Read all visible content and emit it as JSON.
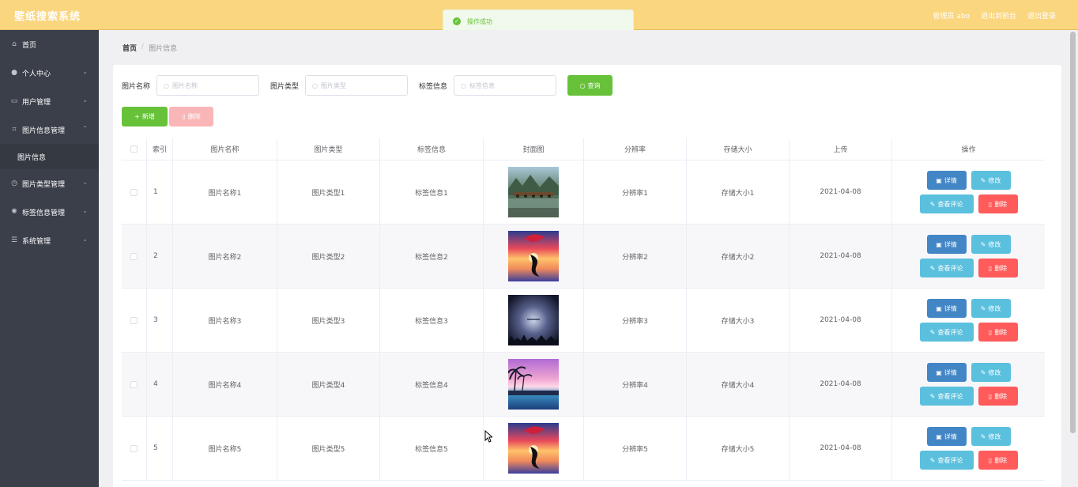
{
  "app": {
    "title": "壁纸搜索系统"
  },
  "topbar": {
    "admin": "管理员 abo",
    "back_frontend": "退出到前台",
    "logout": "退出登录"
  },
  "toast": {
    "message": "操作成功"
  },
  "sidebar": {
    "items": [
      {
        "label": "首页",
        "icon": "home-icon",
        "has_chevron": false
      },
      {
        "label": "个人中心",
        "icon": "user-icon",
        "has_chevron": true
      },
      {
        "label": "用户管理",
        "icon": "id-card-icon",
        "has_chevron": true
      },
      {
        "label": "图片信息管理",
        "icon": "crop-icon",
        "has_chevron": true,
        "expanded": true
      },
      {
        "label": "图片信息",
        "sub": true
      },
      {
        "label": "图片类型管理",
        "icon": "clock-icon",
        "has_chevron": true
      },
      {
        "label": "标签信息管理",
        "icon": "aperture-icon",
        "has_chevron": true
      },
      {
        "label": "系统管理",
        "icon": "stack-icon",
        "has_chevron": true
      }
    ]
  },
  "breadcrumb": {
    "home": "首页",
    "separator": "/",
    "current": "图片信息"
  },
  "search": {
    "fields": [
      {
        "label": "图片名称",
        "placeholder": "图片名称",
        "value": ""
      },
      {
        "label": "图片类型",
        "placeholder": "图片类型",
        "value": ""
      },
      {
        "label": "标签信息",
        "placeholder": "标签信息",
        "value": ""
      }
    ],
    "query_label": "查询"
  },
  "actions": {
    "add_label": "新增",
    "delete_label": "删除"
  },
  "table": {
    "headers": [
      "",
      "索引",
      "图片名称",
      "图片类型",
      "标签信息",
      "封面图",
      "分辨率",
      "存储大小",
      "上传",
      "操作"
    ],
    "rows": [
      {
        "index": "1",
        "name": "图片名称1",
        "type": "图片类型1",
        "tag": "标签信息1",
        "cover": "bridge-landscape",
        "resolution": "分辨率1",
        "size": "存储大小1",
        "uploaded": "2021-04-08"
      },
      {
        "index": "2",
        "name": "图片名称2",
        "type": "图片类型2",
        "tag": "标签信息2",
        "cover": "sunset-dolphin",
        "resolution": "分辨率2",
        "size": "存储大小2",
        "uploaded": "2021-04-08"
      },
      {
        "index": "3",
        "name": "图片名称3",
        "type": "图片类型3",
        "tag": "标签信息3",
        "cover": "night-text",
        "resolution": "分辨率3",
        "size": "存储大小3",
        "uploaded": "2021-04-08"
      },
      {
        "index": "4",
        "name": "图片名称4",
        "type": "图片类型4",
        "tag": "标签信息4",
        "cover": "pink-palms",
        "resolution": "分辨率4",
        "size": "存储大小4",
        "uploaded": "2021-04-08"
      },
      {
        "index": "5",
        "name": "图片名称5",
        "type": "图片类型5",
        "tag": "标签信息5",
        "cover": "sunset-dolphin",
        "resolution": "分辨率5",
        "size": "存储大小5",
        "uploaded": "2021-04-08"
      }
    ],
    "op_labels": {
      "detail": "详情",
      "edit": "修改",
      "comments": "查看评论",
      "remove": "删除"
    }
  },
  "colors": {
    "topbar": "#fad67f",
    "sidebar": "#3b3f4a",
    "success": "#67c23a",
    "primary_op": "#4386c6",
    "info_op": "#5bc0de",
    "danger_op": "#ff5b5b"
  }
}
